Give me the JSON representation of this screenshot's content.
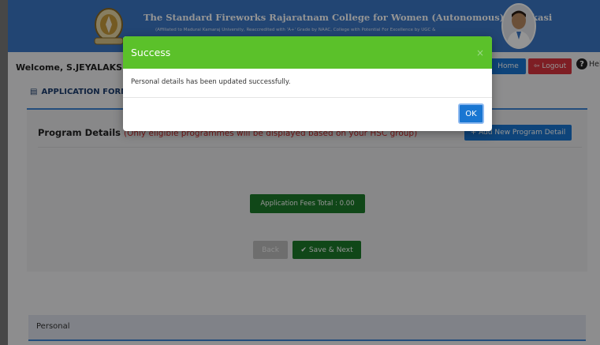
{
  "header": {
    "college_name": "The Standard Fireworks Rajaratnam College for Women (Autonomous), Sivakasi",
    "college_subtitle": "(Affiliated to Madurai Kamaraj University, Reaccredited with 'A+' Grade by NAAC, College with Potential For Excellence by UGC &"
  },
  "nav": {
    "welcome": "Welcome, S.JEYALAKSHMI",
    "home_label": "Home",
    "logout_label": "Logout",
    "help_label": "Help"
  },
  "section": {
    "app_form_label": "APPLICATION FORM"
  },
  "program": {
    "title": "Program Details",
    "note": "(Only eligible programmes will be displayed based on your HSC group)",
    "add_button": "+ Add New Program Detail",
    "fees_label": "Application Fees Total : 0.00",
    "back_label": "Back",
    "save_label": "Save & Next"
  },
  "personal": {
    "label": "Personal"
  },
  "modal": {
    "title": "Success",
    "close": "×",
    "message": "Personal details has been updated successfully.",
    "ok_label": "OK"
  },
  "colors": {
    "header_bg": "#3b78c7",
    "success_green": "#5bc12a",
    "primary_blue": "#1976d2",
    "danger_red": "#d9343e",
    "fees_green": "#1d7a2a"
  }
}
